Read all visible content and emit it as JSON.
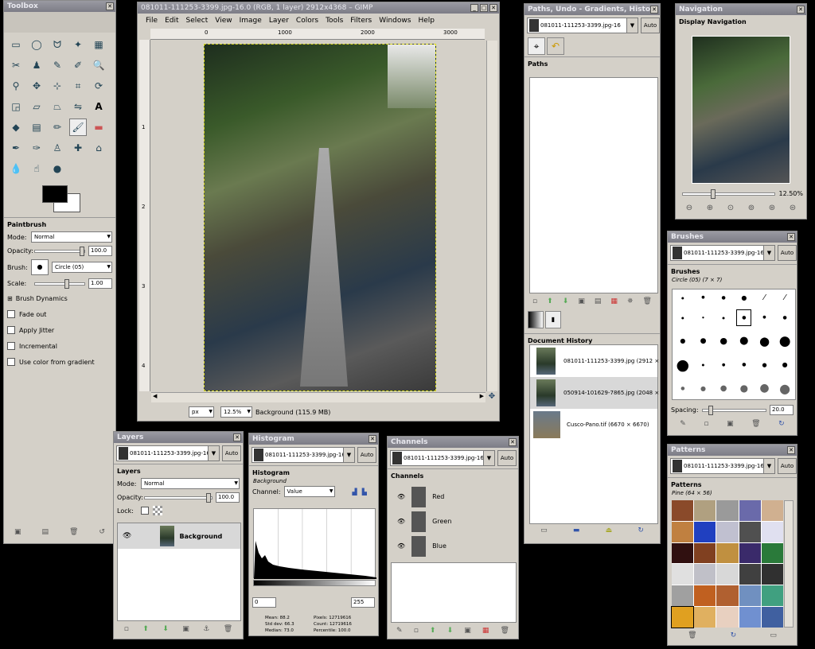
{
  "toolbox": {
    "title": "Toolbox",
    "options_title": "Paintbrush",
    "mode_label": "Mode:",
    "mode_value": "Normal",
    "opacity_label": "Opacity:",
    "opacity_value": "100.0",
    "brush_label": "Brush:",
    "brush_value": "Circle (05)",
    "scale_label": "Scale:",
    "scale_value": "1.00",
    "brush_dynamics": "Brush Dynamics",
    "checks": [
      "Fade out",
      "Apply Jitter",
      "Incremental",
      "Use color from gradient"
    ],
    "fg_color": "#000000",
    "bg_color": "#ffffff"
  },
  "image_window": {
    "title": "081011-111253-3399.jpg-16.0 (RGB, 1 layer) 2912x4368 – GIMP",
    "menus": [
      "File",
      "Edit",
      "Select",
      "View",
      "Image",
      "Layer",
      "Colors",
      "Tools",
      "Filters",
      "Windows",
      "Help"
    ],
    "ruler_marks": [
      "0",
      "1000",
      "2000",
      "3000"
    ],
    "v_ruler_marks": [
      "1",
      "2",
      "3",
      "4"
    ],
    "unit": "px",
    "zoom": "12.5%",
    "status": "Background (115.9 MB)"
  },
  "paths_dock": {
    "title": "Paths, Undo - Gradients, History",
    "image": "081011-111253-3399.jpg-16",
    "auto": "Auto",
    "paths_title": "Paths",
    "doc_history_title": "Document History",
    "docs": [
      "081011-111253-3399.jpg (2912 × 4",
      "050914-101629-7865.jpg (2048 × 3",
      "Cusco-Pano.tif (6670 × 6670)"
    ]
  },
  "navigation": {
    "title": "Navigation",
    "subtitle": "Display Navigation",
    "zoom": "12.50%"
  },
  "brushes": {
    "title": "Brushes",
    "image": "081011-111253-3399.jpg-16",
    "auto": "Auto",
    "section": "Brushes",
    "current": "Circle (05) (7 × 7)",
    "spacing_label": "Spacing:",
    "spacing_value": "20.0"
  },
  "patterns": {
    "title": "Patterns",
    "image": "081011-111253-3399.jpg-16",
    "auto": "Auto",
    "section": "Patterns",
    "current": "Pine (64 × 56)"
  },
  "layers": {
    "title": "Layers",
    "image": "081011-111253-3399.jpg-16",
    "auto": "Auto",
    "section": "Layers",
    "mode_label": "Mode:",
    "mode_value": "Normal",
    "opacity_label": "Opacity:",
    "opacity_value": "100.0",
    "lock_label": "Lock:",
    "layer_name": "Background"
  },
  "histogram": {
    "title": "Histogram",
    "image": "081011-111253-3399.jpg-16",
    "auto": "Auto",
    "section": "Histogram",
    "layer": "Background",
    "channel_label": "Channel:",
    "channel_value": "Value",
    "range_min": "0",
    "range_max": "255",
    "stats": [
      {
        "k": "Mean:",
        "v": "88.2"
      },
      {
        "k": "Std dev:",
        "v": "66.3"
      },
      {
        "k": "Median:",
        "v": "73.0"
      },
      {
        "k": "Pixels:",
        "v": "12719616"
      },
      {
        "k": "Count:",
        "v": "12719616"
      },
      {
        "k": "Percentile:",
        "v": "100.0"
      }
    ]
  },
  "channels": {
    "title": "Channels",
    "image": "081011-111253-3399.jpg-16",
    "auto": "Auto",
    "section": "Channels",
    "items": [
      "Red",
      "Green",
      "Blue"
    ]
  }
}
